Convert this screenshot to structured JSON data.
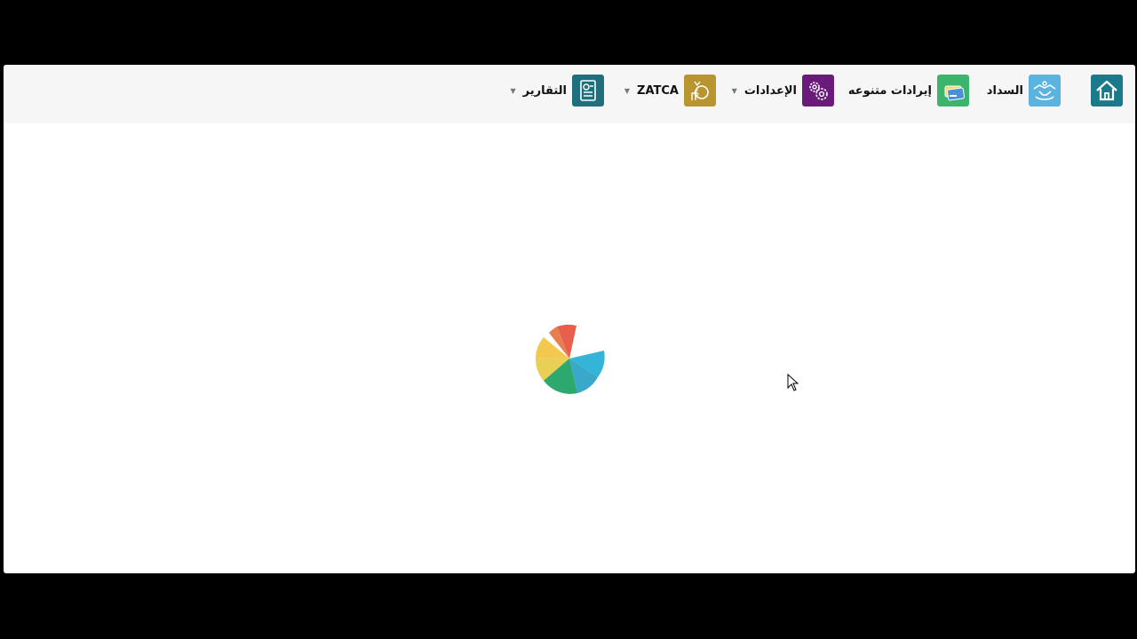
{
  "navbar": {
    "items": [
      {
        "label": "",
        "icon": "home-icon",
        "color": "#1a7a8c"
      },
      {
        "label": "السداد",
        "icon": "handshake-icon",
        "color": "#5bb3df"
      },
      {
        "label": "إيرادات متنوعه",
        "icon": "card-icon",
        "color": "#3db46d"
      },
      {
        "label": "الإعدادات",
        "icon": "gears-icon",
        "color": "#6a1b7a",
        "dropdown": true
      },
      {
        "label": "ZATCA",
        "icon": "money-bag-icon",
        "color": "#b8952e",
        "dropdown": true
      },
      {
        "label": "التقارير",
        "icon": "report-icon",
        "color": "#1f6f7d",
        "dropdown": true
      }
    ]
  },
  "loader": {
    "icon": "loading-spinner-icon",
    "colors": [
      "#e8604c",
      "#f2c94c",
      "#34b4d8",
      "#2da86e"
    ]
  }
}
